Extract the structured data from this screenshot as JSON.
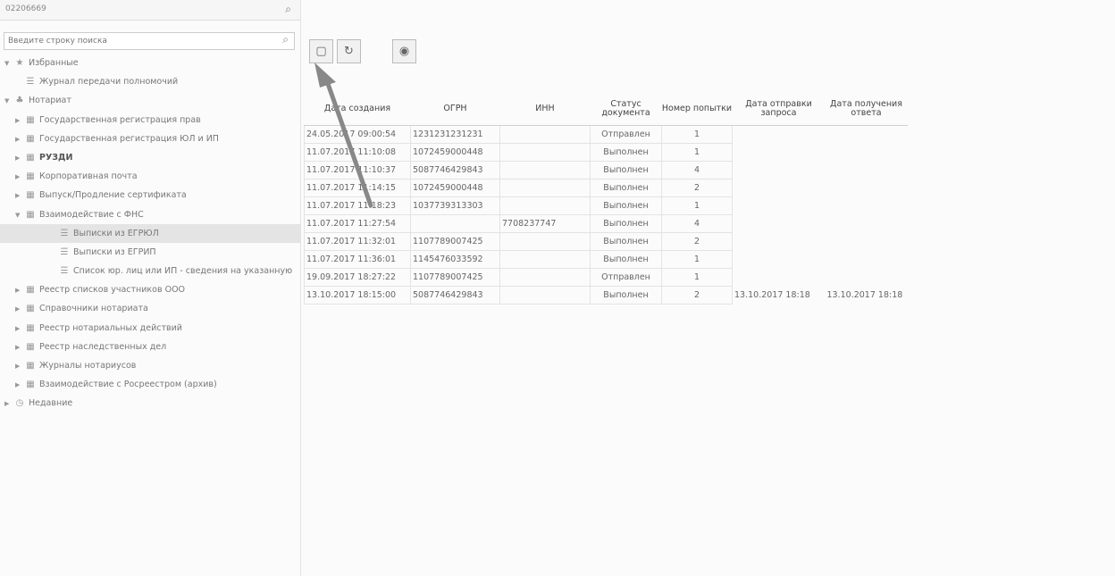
{
  "sidebar": {
    "title": "02206669",
    "search_placeholder": "Введите строку поиска",
    "tree": [
      {
        "label": "Избранные",
        "level": 0,
        "expand": "▼",
        "icon": "★"
      },
      {
        "label": "Журнал передачи полномочий",
        "level": 1,
        "expand": "",
        "icon": "☰"
      },
      {
        "label": "Нотариат",
        "level": 0,
        "expand": "▼",
        "icon": "♣"
      },
      {
        "label": "Государственная регистрация прав",
        "level": 1,
        "expand": "▶",
        "icon": "▦"
      },
      {
        "label": "Государственная регистрация ЮЛ и ИП",
        "level": 1,
        "expand": "▶",
        "icon": "▦"
      },
      {
        "label": "РУЗДИ",
        "level": 1,
        "expand": "▶",
        "icon": "▦",
        "bold": true
      },
      {
        "label": "Корпоративная почта",
        "level": 1,
        "expand": "▶",
        "icon": "▦"
      },
      {
        "label": "Выпуск/Продление сертификата",
        "level": 1,
        "expand": "▶",
        "icon": "▦"
      },
      {
        "label": "Взаимодействие с ФНС",
        "level": 1,
        "expand": "▼",
        "icon": "▦"
      },
      {
        "label": "Выписки из ЕГРЮЛ",
        "level": 2,
        "expand": "",
        "icon": "☰",
        "selected": true
      },
      {
        "label": "Выписки из ЕГРИП",
        "level": 2,
        "expand": "",
        "icon": "☰"
      },
      {
        "label": "Список юр. лиц или ИП - сведения на указанную",
        "level": 2,
        "expand": "",
        "icon": "☰"
      },
      {
        "label": "Реестр списков участников ООО",
        "level": 1,
        "expand": "▶",
        "icon": "▦"
      },
      {
        "label": "Справочники нотариата",
        "level": 1,
        "expand": "▶",
        "icon": "▦"
      },
      {
        "label": "Реестр нотариальных действий",
        "level": 1,
        "expand": "▶",
        "icon": "▦"
      },
      {
        "label": "Реестр наследственных дел",
        "level": 1,
        "expand": "▶",
        "icon": "▦"
      },
      {
        "label": "Журналы нотариусов",
        "level": 1,
        "expand": "▶",
        "icon": "▦"
      },
      {
        "label": "Взаимодействие с Росреестром (архив)",
        "level": 1,
        "expand": "▶",
        "icon": "▦"
      },
      {
        "label": "Недавние",
        "level": 0,
        "expand": "▶",
        "icon": "◷"
      }
    ]
  },
  "toolbar": {
    "buttons": [
      {
        "name": "new-button",
        "glyph": "▢"
      },
      {
        "name": "refresh-button",
        "glyph": "↻"
      },
      {
        "name": "settings-button",
        "glyph": "◉"
      }
    ]
  },
  "grid": {
    "columns": [
      "Дата создания",
      "ОГРН",
      "ИНН",
      "Статус документа",
      "Номер попытки",
      "Дата отправки запроса",
      "Дата получения ответа"
    ],
    "rows": [
      [
        "24.05.2017 09:00:54",
        "1231231231231",
        "",
        "Отправлен",
        "1",
        "",
        ""
      ],
      [
        "11.07.2017 11:10:08",
        "1072459000448",
        "",
        "Выполнен",
        "1",
        "",
        ""
      ],
      [
        "11.07.2017 11:10:37",
        "5087746429843",
        "",
        "Выполнен",
        "4",
        "",
        ""
      ],
      [
        "11.07.2017 11:14:15",
        "1072459000448",
        "",
        "Выполнен",
        "2",
        "",
        ""
      ],
      [
        "11.07.2017 11:18:23",
        "1037739313303",
        "",
        "Выполнен",
        "1",
        "",
        ""
      ],
      [
        "11.07.2017 11:27:54",
        "",
        "7708237747",
        "Выполнен",
        "4",
        "",
        ""
      ],
      [
        "11.07.2017 11:32:01",
        "1107789007425",
        "",
        "Выполнен",
        "2",
        "",
        ""
      ],
      [
        "11.07.2017 11:36:01",
        "1145476033592",
        "",
        "Выполнен",
        "1",
        "",
        ""
      ],
      [
        "19.09.2017 18:27:22",
        "1107789007425",
        "",
        "Отправлен",
        "1",
        "",
        ""
      ],
      [
        "13.10.2017 18:15:00",
        "5087746429843",
        "",
        "Выполнен",
        "2",
        "13.10.2017 18:18",
        "13.10.2017 18:18"
      ]
    ]
  }
}
